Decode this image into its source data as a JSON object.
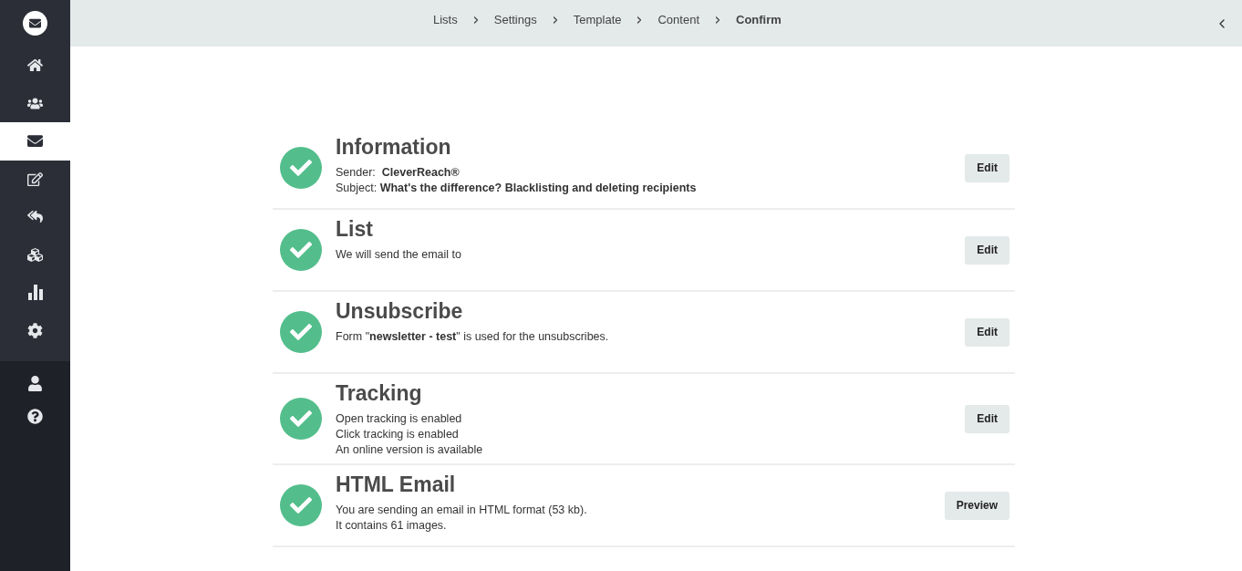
{
  "sidebar": {
    "nav": [
      {
        "selected": false
      },
      {
        "selected": false
      },
      {
        "selected": true
      },
      {
        "selected": false
      },
      {
        "selected": false
      },
      {
        "selected": false
      },
      {
        "selected": false
      },
      {
        "selected": false
      }
    ]
  },
  "breadcrumb": [
    {
      "label": "Lists",
      "selected": false
    },
    {
      "label": "Settings",
      "selected": false
    },
    {
      "label": "Template",
      "selected": false
    },
    {
      "label": "Content",
      "selected": false
    },
    {
      "label": "Confirm",
      "selected": true
    }
  ],
  "sections": [
    {
      "title": "Information",
      "complete": true,
      "lines": [
        "Sender:  **CleverReach®**",
        "Subject: **What's the difference? Blacklisting and deleting recipients**"
      ],
      "button": "Edit"
    },
    {
      "title": "List",
      "complete": true,
      "lines": [
        "We will send the email to"
      ],
      "button": "Edit"
    },
    {
      "title": "Unsubscribe",
      "complete": true,
      "lines": [
        "Form \"**newsletter - test**\" is used for the unsubscribes."
      ],
      "button": "Edit"
    },
    {
      "title": "Tracking",
      "complete": true,
      "lines": [
        "Open tracking is enabled",
        "Click tracking is enabled",
        "An online version is available"
      ],
      "button": "Edit"
    },
    {
      "title": "HTML Email",
      "complete": true,
      "lines": [
        "You are sending an email in HTML format (53 kb).",
        "It contains 61 images."
      ],
      "button": "Preview"
    }
  ]
}
